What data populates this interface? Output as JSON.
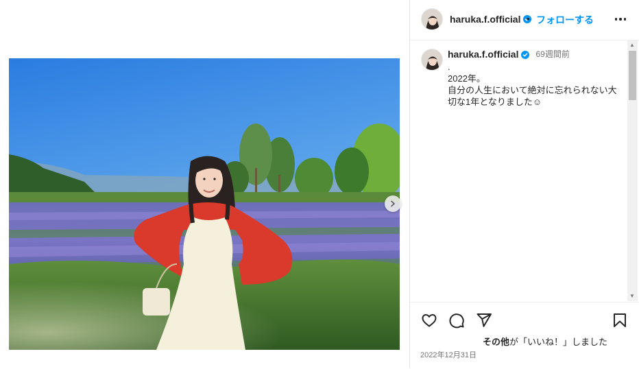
{
  "header": {
    "username": "haruka.f.official",
    "separator": "•",
    "follow_label": "フォローする",
    "more_icon": "more-horizontal-icon"
  },
  "caption": {
    "username": "haruka.f.official",
    "time_ago": "69週間前",
    "text": ".\n2022年。\n自分の人生において絶対に忘れられない大切な1年となりました☺︎"
  },
  "post": {
    "image_alt": "woman in white dress and red cardigan standing in a lavender field",
    "next_icon": "chevron-right-icon"
  },
  "likes": {
    "name": "その他",
    "suffix": "が「いいね！」しました"
  },
  "date": "2022年12月31日",
  "colors": {
    "accent": "#0095f6",
    "verified": "#0095f6",
    "text": "#262626",
    "muted": "#737373"
  },
  "icons": [
    "heart-icon",
    "comment-icon",
    "share-icon",
    "bookmark-icon",
    "verified-icon"
  ]
}
